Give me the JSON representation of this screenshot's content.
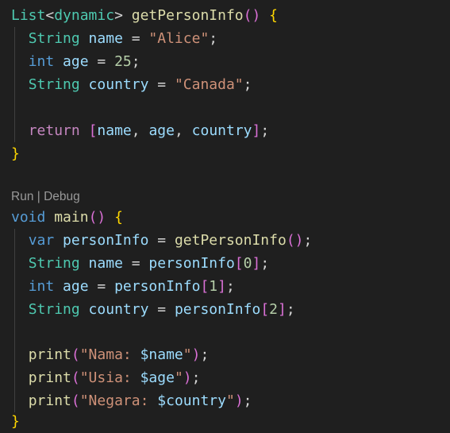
{
  "colors": {
    "background": "#1f1f1f",
    "type": "#4ec9b0",
    "keyword": "#569cd6",
    "control": "#c586c0",
    "function": "#dcdcaa",
    "variable": "#9cdcfe",
    "string": "#ce9178",
    "number": "#b5cea8",
    "bracket_level_1": "#ffd700",
    "bracket_level_2": "#da70d6",
    "bracket_level_3": "#179fff"
  },
  "codelens": {
    "run": "Run",
    "separator": " | ",
    "debug": "Debug"
  },
  "code": {
    "l1": {
      "type": "List",
      "lt": "<",
      "generic": "dynamic",
      "gt": ">",
      "space": " ",
      "fn": "getPersonInfo",
      "open": "(",
      "close": ")",
      "brace": " {"
    },
    "l2": {
      "indent": "  ",
      "type": "String",
      "name": " name",
      "eq": " = ",
      "value": "\"Alice\"",
      "semi": ";"
    },
    "l3": {
      "indent": "  ",
      "type": "int",
      "name": " age",
      "eq": " = ",
      "value": "25",
      "semi": ";"
    },
    "l4": {
      "indent": "  ",
      "type": "String",
      "name": " country",
      "eq": " = ",
      "value": "\"Canada\"",
      "semi": ";"
    },
    "l6": {
      "indent": "  ",
      "kw": "return",
      "sp": " ",
      "open": "[",
      "a": "name",
      "c1": ", ",
      "b": "age",
      "c2": ", ",
      "c": "country",
      "close": "]",
      "semi": ";"
    },
    "l7": {
      "brace": "}"
    },
    "l9": {
      "kw": "void",
      "sp": " ",
      "fn": "main",
      "open": "(",
      "close": ")",
      "sp2": " ",
      "brace": "{"
    },
    "l10": {
      "indent": "  ",
      "kw": "var",
      "name": " personInfo",
      "eq": " = ",
      "fn": "getPersonInfo",
      "open": "(",
      "close": ")",
      "semi": ";"
    },
    "l11": {
      "indent": "  ",
      "type": "String",
      "name": " name",
      "eq": " = ",
      "src": "personInfo",
      "open": "[",
      "idx": "0",
      "close": "]",
      "semi": ";"
    },
    "l12": {
      "indent": "  ",
      "type": "int",
      "name": " age",
      "eq": " = ",
      "src": "personInfo",
      "open": "[",
      "idx": "1",
      "close": "]",
      "semi": ";"
    },
    "l13": {
      "indent": "  ",
      "type": "String",
      "name": " country",
      "eq": " = ",
      "src": "personInfo",
      "open": "[",
      "idx": "2",
      "close": "]",
      "semi": ";"
    },
    "l15": {
      "indent": "  ",
      "fn": "print",
      "open": "(",
      "str": "\"Nama: ",
      "interp": "$name",
      "strend": "\"",
      "close": ")",
      "semi": ";"
    },
    "l16": {
      "indent": "  ",
      "fn": "print",
      "open": "(",
      "str": "\"Usia: ",
      "interp": "$age",
      "strend": "\"",
      "close": ")",
      "semi": ";"
    },
    "l17": {
      "indent": "  ",
      "fn": "print",
      "open": "(",
      "str": "\"Negara: ",
      "interp": "$country",
      "strend": "\"",
      "close": ")",
      "semi": ";"
    },
    "l18": {
      "brace": "}"
    }
  }
}
